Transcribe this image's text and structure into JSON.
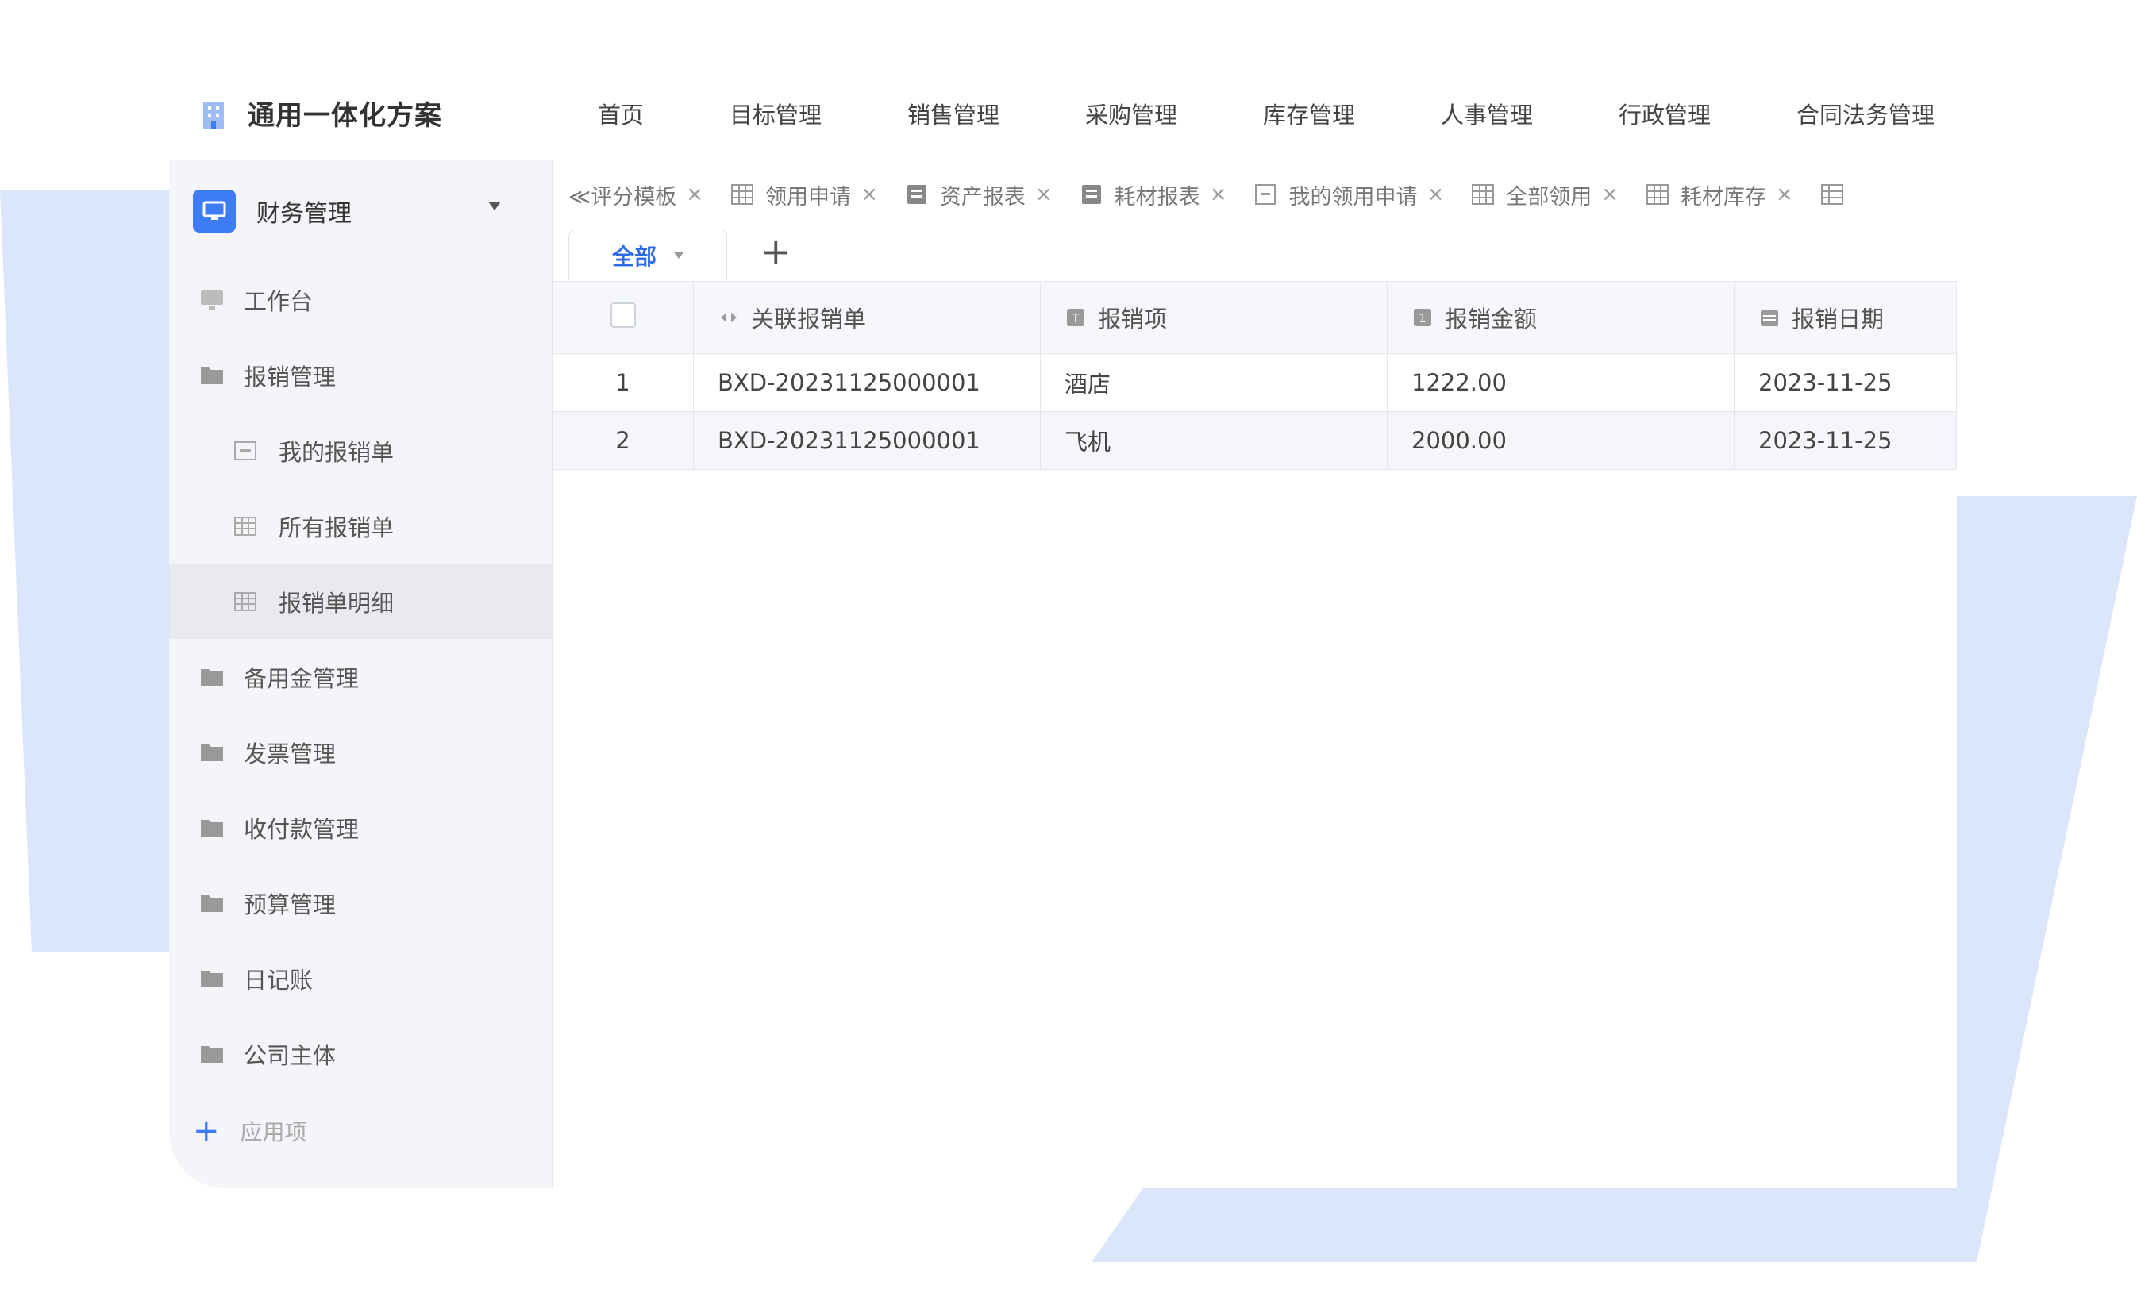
{
  "colors": {
    "accent": "#3d7cf5",
    "decor": "#dce6fb",
    "sidebar_bg": "#f4f5f9"
  },
  "brand": {
    "title": "通用一体化方案",
    "icon": "building-icon"
  },
  "nav": [
    "首页",
    "目标管理",
    "销售管理",
    "采购管理",
    "库存管理",
    "人事管理",
    "行政管理",
    "合同法务管理"
  ],
  "sidebar": {
    "header": "财务管理",
    "items": [
      {
        "label": "工作台",
        "icon": "monitor-icon"
      },
      {
        "label": "报销管理",
        "icon": "folder-open-icon"
      },
      {
        "label": "我的报销单",
        "icon": "form-icon"
      },
      {
        "label": "所有报销单",
        "icon": "table-icon"
      },
      {
        "label": "报销单明细",
        "icon": "table-icon"
      },
      {
        "label": "备用金管理",
        "icon": "folder-icon"
      },
      {
        "label": "发票管理",
        "icon": "folder-icon"
      },
      {
        "label": "收付款管理",
        "icon": "folder-icon"
      },
      {
        "label": "预算管理",
        "icon": "folder-icon"
      },
      {
        "label": "日记账",
        "icon": "folder-icon"
      },
      {
        "label": "公司主体",
        "icon": "folder-icon"
      }
    ],
    "add_label": "应用项"
  },
  "tabs": [
    {
      "label": "≪评分模板",
      "icon": ""
    },
    {
      "label": "领用申请",
      "icon": "table-icon"
    },
    {
      "label": "资产报表",
      "icon": "report-icon"
    },
    {
      "label": "耗材报表",
      "icon": "report-icon"
    },
    {
      "label": "我的领用申请",
      "icon": "form-icon"
    },
    {
      "label": "全部领用",
      "icon": "table-icon"
    },
    {
      "label": "耗材库存",
      "icon": "table-icon"
    }
  ],
  "view": {
    "label": "全部"
  },
  "table": {
    "columns": [
      "关联报销单",
      "报销项",
      "报销金额",
      "报销日期"
    ],
    "rows": [
      {
        "idx": "1",
        "bill": "BXD-20231125000001",
        "item": "酒店",
        "amount": "1222.00",
        "date": "2023-11-25"
      },
      {
        "idx": "2",
        "bill": "BXD-20231125000001",
        "item": "飞机",
        "amount": "2000.00",
        "date": "2023-11-25"
      }
    ]
  }
}
